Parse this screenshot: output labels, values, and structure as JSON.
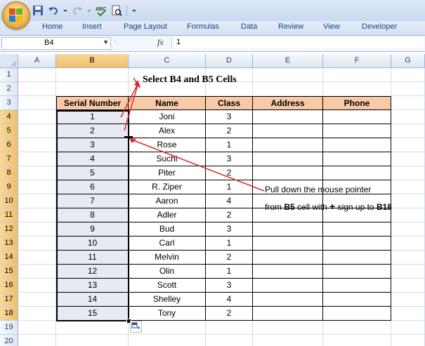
{
  "ribbon": {
    "tabs": [
      "Home",
      "Insert",
      "Page Layout",
      "Formulas",
      "Data",
      "Review",
      "View",
      "Developer"
    ]
  },
  "formula_bar": {
    "name_box": "B4",
    "fx_label": "fx",
    "formula": "1"
  },
  "columns": [
    "A",
    "B",
    "C",
    "D",
    "E",
    "F",
    "G"
  ],
  "rows": [
    "1",
    "2",
    "3",
    "4",
    "5",
    "6",
    "7",
    "8",
    "9",
    "10",
    "11",
    "12",
    "13",
    "14",
    "15",
    "16",
    "17",
    "18",
    "19",
    "20"
  ],
  "table": {
    "headers": [
      "Serial Number",
      "Name",
      "Class",
      "Address",
      "Phone"
    ],
    "rows": [
      [
        "1",
        "Joni",
        "3"
      ],
      [
        "2",
        "Alex",
        "2"
      ],
      [
        "3",
        "Rose",
        "1"
      ],
      [
        "4",
        "Suchi",
        "3"
      ],
      [
        "5",
        "Piter",
        "2"
      ],
      [
        "6",
        "R. Ziper",
        "1"
      ],
      [
        "7",
        "Aaron",
        "4"
      ],
      [
        "8",
        "Adler",
        "2"
      ],
      [
        "9",
        "Bud",
        "3"
      ],
      [
        "10",
        "Carl",
        "1"
      ],
      [
        "11",
        "Melvin",
        "2"
      ],
      [
        "12",
        "Olin",
        "1"
      ],
      [
        "13",
        "Scott",
        "3"
      ],
      [
        "14",
        "Shelley",
        "4"
      ],
      [
        "15",
        "Tony",
        "2"
      ]
    ]
  },
  "annotations": {
    "title": "Select B4 and B5 Cells",
    "line1": "Pull down the mouse pointer",
    "line2_from": "from ",
    "line2_b5": "B5",
    "line2_mid": " cell with ",
    "line2_plus": "+",
    "line2_mid2": " sign up to ",
    "line2_b18": "B18"
  },
  "colors": {
    "header_fill": "#f8c9a6",
    "arrow": "#e0262a",
    "selection_fill": "#e7eaf2"
  }
}
